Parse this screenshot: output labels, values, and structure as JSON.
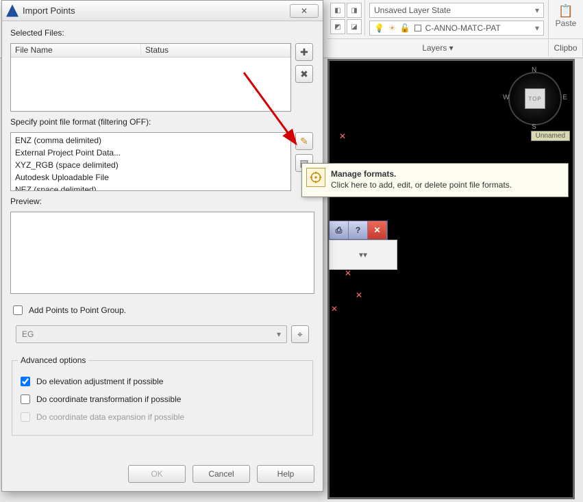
{
  "ribbon": {
    "layer_state": "Unsaved Layer State",
    "layer_value": "C-ANNO-MATC-PAT",
    "panel_layers": "Layers ▾",
    "panel_clip": "Clipbo",
    "paste_label": "Paste"
  },
  "viewport": {
    "top_face": "TOP",
    "dir_n": "N",
    "dir_s": "S",
    "dir_e": "E",
    "dir_w": "W",
    "tag": "Unnamed"
  },
  "dialog": {
    "title": "Import Points",
    "close_glyph": "✕",
    "selected_files_label": "Selected Files:",
    "col_file": "File Name",
    "col_status": "Status",
    "add_glyph": "✚",
    "remove_glyph": "✖",
    "format_label": "Specify point file format (filtering OFF):",
    "format_items": [
      "ENZ (comma delimited)",
      "External Project Point Data...",
      "XYZ_RGB (space delimited)",
      "Autodesk Uploadable File",
      "NEZ (space delimited)"
    ],
    "manage_glyph": "✎",
    "browse_glyph": "▤",
    "preview_label": "Preview:",
    "add_group_label": "Add Points to Point Group.",
    "group_value": "EG",
    "pick_glyph": "⌖",
    "adv_legend": "Advanced options",
    "opt_elev": "Do elevation adjustment if possible",
    "opt_coord": "Do coordinate transformation if possible",
    "opt_expand": "Do coordinate data expansion if possible",
    "btn_ok": "OK",
    "btn_cancel": "Cancel",
    "btn_help": "Help"
  },
  "tooltip": {
    "title": "Manage formats.",
    "body": "Click here to add, edit, or delete point file formats."
  },
  "mini_toolbar": {
    "a": "⎙",
    "b": "?",
    "c": "✕",
    "d": "▾▾"
  }
}
